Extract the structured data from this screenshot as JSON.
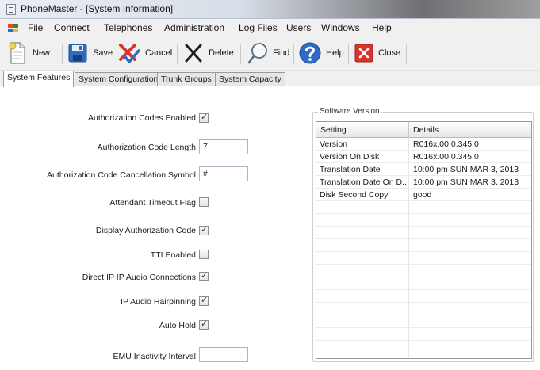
{
  "window": {
    "title": "PhoneMaster - [System Information]"
  },
  "menu": {
    "app_icon": "app-menu-icon",
    "items": [
      "File",
      "Connect",
      "Telephones",
      "Administration",
      "Log Files",
      "Users",
      "Windows",
      "Help"
    ]
  },
  "toolbar": {
    "buttons": [
      {
        "label": "New",
        "icon": "new-document-icon"
      },
      {
        "label": "Save",
        "icon": "floppy-disk-icon"
      },
      {
        "label": "Cancel",
        "icon": "cancel-icon"
      },
      {
        "label": "Delete",
        "icon": "delete-x-icon"
      },
      {
        "label": "Find",
        "icon": "magnifier-icon"
      },
      {
        "label": "Help",
        "icon": "question-icon"
      },
      {
        "label": "Close",
        "icon": "close-icon"
      }
    ]
  },
  "tabs": [
    "System Features",
    "System Configuration",
    "Trunk Groups",
    "System Capacity"
  ],
  "active_tab": "System Features",
  "features": {
    "auth_codes_enabled": {
      "label": "Authorization Codes Enabled",
      "checked": true
    },
    "auth_code_length": {
      "label": "Authorization Code Length",
      "value": "7"
    },
    "auth_cancel_symbol": {
      "label": "Authorization Code Cancellation Symbol",
      "value": "#"
    },
    "attendant_timeout": {
      "label": "Attendant Timeout Flag",
      "checked": false
    },
    "display_auth_code": {
      "label": "Display Authorization Code",
      "checked": true
    },
    "tti_enabled": {
      "label": "TTI Enabled",
      "checked": false
    },
    "direct_ip_audio": {
      "label": "Direct IP IP Audio Connections",
      "checked": true
    },
    "ip_audio_hairpinning": {
      "label": "IP Audio Hairpinning",
      "checked": true
    },
    "auto_hold": {
      "label": "Auto Hold",
      "checked": true
    },
    "emu_inactivity": {
      "label": "EMU Inactivity Interval",
      "value": ""
    }
  },
  "software_version": {
    "title": "Software Version",
    "columns": [
      "Setting",
      "Details"
    ],
    "rows": [
      [
        "Version",
        "R016x.00.0.345.0"
      ],
      [
        "Version On Disk",
        "R016x.00.0.345.0"
      ],
      [
        "Translation Date",
        "10:00 pm  SUN MAR 3, 2013"
      ],
      [
        "Translation Date On D...",
        "10:00 pm  SUN MAR 3, 2013"
      ],
      [
        "Disk Second Copy",
        "good"
      ]
    ]
  },
  "check_glyph": "✓",
  "colors": {
    "accent_blue": "#2d6bc4",
    "cancel_red": "#d9362b"
  }
}
